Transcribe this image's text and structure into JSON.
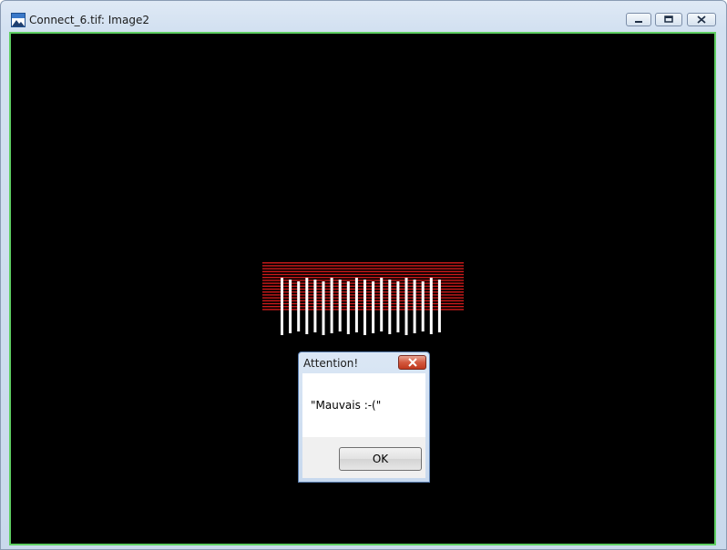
{
  "window": {
    "title": "Connect_6.tif: Image2",
    "icon": "image-app-icon",
    "controls": [
      "minimize-icon",
      "maximize-icon",
      "close-icon"
    ],
    "canvas_border_color": "#5fcf63",
    "canvas_background": "#000000"
  },
  "image": {
    "stripe_color": "#cc1a1a",
    "tooth_color": "#ffffff"
  },
  "dialog": {
    "title": "Attention!",
    "message": "\"Mauvais :-(\"",
    "ok_label": "OK",
    "close_icon": "close-icon"
  }
}
